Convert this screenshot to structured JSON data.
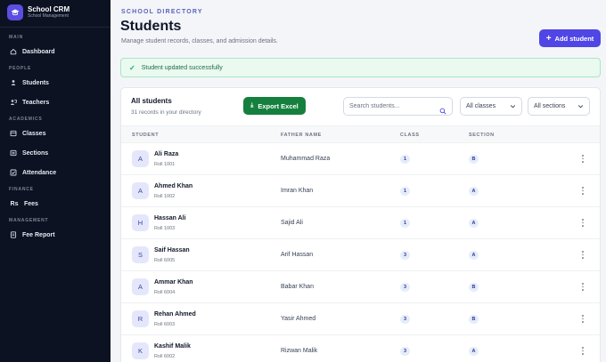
{
  "brand": {
    "title": "School CRM",
    "subtitle": "School Management"
  },
  "sidebar": {
    "sections": [
      {
        "label": "MAIN",
        "items": [
          {
            "label": "Dashboard",
            "icon": "home-icon"
          }
        ]
      },
      {
        "label": "PEOPLE",
        "items": [
          {
            "label": "Students",
            "icon": "user-icon"
          },
          {
            "label": "Teachers",
            "icon": "teacher-icon"
          }
        ]
      },
      {
        "label": "ACADEMICS",
        "items": [
          {
            "label": "Classes",
            "icon": "classes-icon"
          },
          {
            "label": "Sections",
            "icon": "sections-icon"
          },
          {
            "label": "Attendance",
            "icon": "attendance-icon"
          }
        ]
      },
      {
        "label": "FINANCE",
        "items": [
          {
            "label": "Fees",
            "icon": "rupee-icon",
            "icon_text": "Rs"
          }
        ]
      },
      {
        "label": "MANAGEMENT",
        "items": [
          {
            "label": "Fee Report",
            "icon": "report-icon"
          }
        ]
      }
    ]
  },
  "header": {
    "eyebrow": "SCHOOL DIRECTORY",
    "title": "Students",
    "subtitle": "Manage student records, classes, and admission details.",
    "add_button": "Add student"
  },
  "alert": {
    "message": "Student updated successfully"
  },
  "card": {
    "title": "All students",
    "subtitle": "31 records in your directory",
    "export_button": "Export Excel",
    "search_placeholder": "Search students...",
    "class_filter": "All classes",
    "section_filter": "All sections"
  },
  "table": {
    "columns": {
      "student": "STUDENT",
      "father": "FATHER NAME",
      "class": "CLASS",
      "section": "SECTION"
    },
    "rows": [
      {
        "initial": "A",
        "name": "Ali Raza",
        "roll": "Roll 1001",
        "father": "Muhammad Raza",
        "class": "1",
        "section": "B"
      },
      {
        "initial": "A",
        "name": "Ahmed Khan",
        "roll": "Roll 1002",
        "father": "Imran Khan",
        "class": "1",
        "section": "A"
      },
      {
        "initial": "H",
        "name": "Hassan Ali",
        "roll": "Roll 1003",
        "father": "Sajid Ali",
        "class": "1",
        "section": "A"
      },
      {
        "initial": "S",
        "name": "Saif Hassan",
        "roll": "Roll 6005",
        "father": "Arif Hassan",
        "class": "3",
        "section": "A"
      },
      {
        "initial": "A",
        "name": "Ammar Khan",
        "roll": "Roll 6004",
        "father": "Babar Khan",
        "class": "3",
        "section": "B"
      },
      {
        "initial": "R",
        "name": "Rehan Ahmed",
        "roll": "Roll 6003",
        "father": "Yasir Ahmed",
        "class": "3",
        "section": "B"
      },
      {
        "initial": "K",
        "name": "Kashif Malik",
        "roll": "Roll 6002",
        "father": "Rizwan Malik",
        "class": "3",
        "section": "A"
      }
    ]
  },
  "colors": {
    "accent": "#4f46e5",
    "export": "#15803d",
    "sidebar_bg": "#0c1222",
    "success_bg": "#eafaf1"
  }
}
